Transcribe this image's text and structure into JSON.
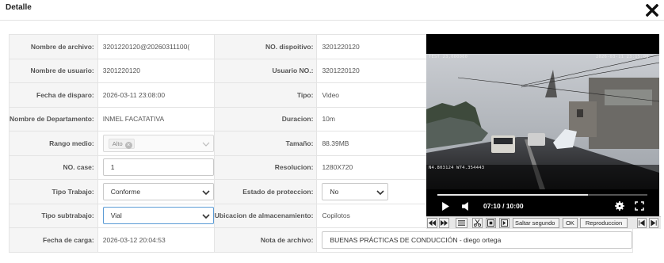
{
  "dialog": {
    "title": "Detalle",
    "close_icon": "close-icon"
  },
  "fields": {
    "nombre_archivo": {
      "label": "Nombre de archivo:",
      "value": "3201220120@20260311100("
    },
    "no_dispositivo": {
      "label": "NO. dispoitivo:",
      "value": "3201220120"
    },
    "nombre_usuario": {
      "label": "Nombre de usuario:",
      "value": "3201220120"
    },
    "usuario_no": {
      "label": "Usuario NO.:",
      "value": "3201220120"
    },
    "fecha_disparo": {
      "label": "Fecha de disparo:",
      "value": "2026-03-11 23:08:00"
    },
    "tipo": {
      "label": "Tipo:",
      "value": "Video"
    },
    "departamento": {
      "label": "Nombre de Departamento:",
      "value": "INMEL FACATATIVA"
    },
    "duracion": {
      "label": "Duracion:",
      "value": "10m"
    },
    "rango_medio": {
      "label": "Rango medio:",
      "chip": "Alto"
    },
    "tamano": {
      "label": "Tamaño:",
      "value": "88.39MB"
    },
    "no_case": {
      "label": "NO. case:",
      "value": "1"
    },
    "resolucion": {
      "label": "Resolucion:",
      "value": "1280X720"
    },
    "tipo_trabajo": {
      "label": "Tipo Trabajo:",
      "value": "Conforme"
    },
    "estado_proteccion": {
      "label": "Estado de proteccion:",
      "value": "No"
    },
    "tipo_subtrabajo": {
      "label": "Tipo subtrabajo:",
      "value": "Vial"
    },
    "ubicacion": {
      "label": "Ubicacion de almacenamiento:",
      "value": "Copilotos"
    },
    "fecha_carga": {
      "label": "Fecha de carga:",
      "value": "2026-03-12 20:04:53"
    },
    "nota_archivo": {
      "label": "Nota de archivo:",
      "value": "BUENAS PRÁCTICAS DE CONDUCCIÓN - diego ortega"
    }
  },
  "player": {
    "osd_top_left": "TEST 23,000000",
    "osd_top_right": "2026-03-11 23:15:00",
    "osd_bottom_left": "N4.803124  W74.354443",
    "time_display": "07:10 / 10:00",
    "progress": 0.717,
    "toolbar": {
      "saltar_label": "Saltar segundo",
      "ok_label": "OK",
      "reproduccion_label": "Reproduccion"
    }
  }
}
